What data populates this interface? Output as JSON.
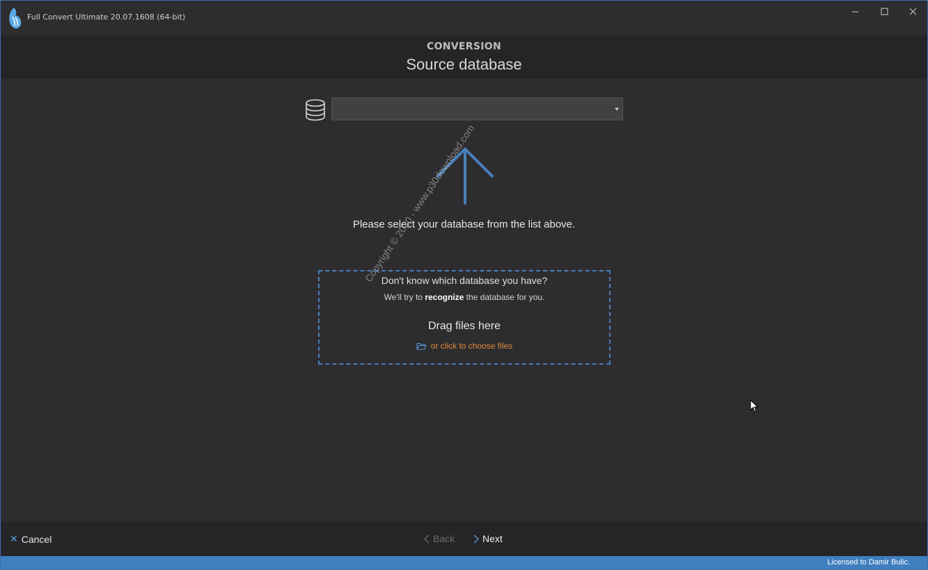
{
  "window": {
    "title": "Full Convert Ultimate 20.07.1608 (64-bit)",
    "controls": {
      "minimize": "minimize-icon",
      "maximize": "maximize-icon",
      "close": "close-icon"
    }
  },
  "header": {
    "kicker": "CONVERSION",
    "title": "Source database"
  },
  "database_select": {
    "value": "",
    "icon": "database-icon"
  },
  "content": {
    "prompt": "Please select your database from the list above."
  },
  "dropzone": {
    "question": "Don't know which database you have?",
    "hint_prefix": "We'll try to ",
    "hint_bold": "recognize",
    "hint_suffix": " the database for you.",
    "drag_label": "Drag files here",
    "choose_label": "or click to choose files"
  },
  "watermark": "Copyright © 2020 - www.p30download.com",
  "footer": {
    "cancel_label": "Cancel",
    "back_label": "Back",
    "next_label": "Next"
  },
  "statusbar": {
    "license": "Licensed to Damir Bulic."
  },
  "colors": {
    "accent": "#3f7fbf",
    "link": "#e08a3a",
    "background": "#2d2d30"
  }
}
